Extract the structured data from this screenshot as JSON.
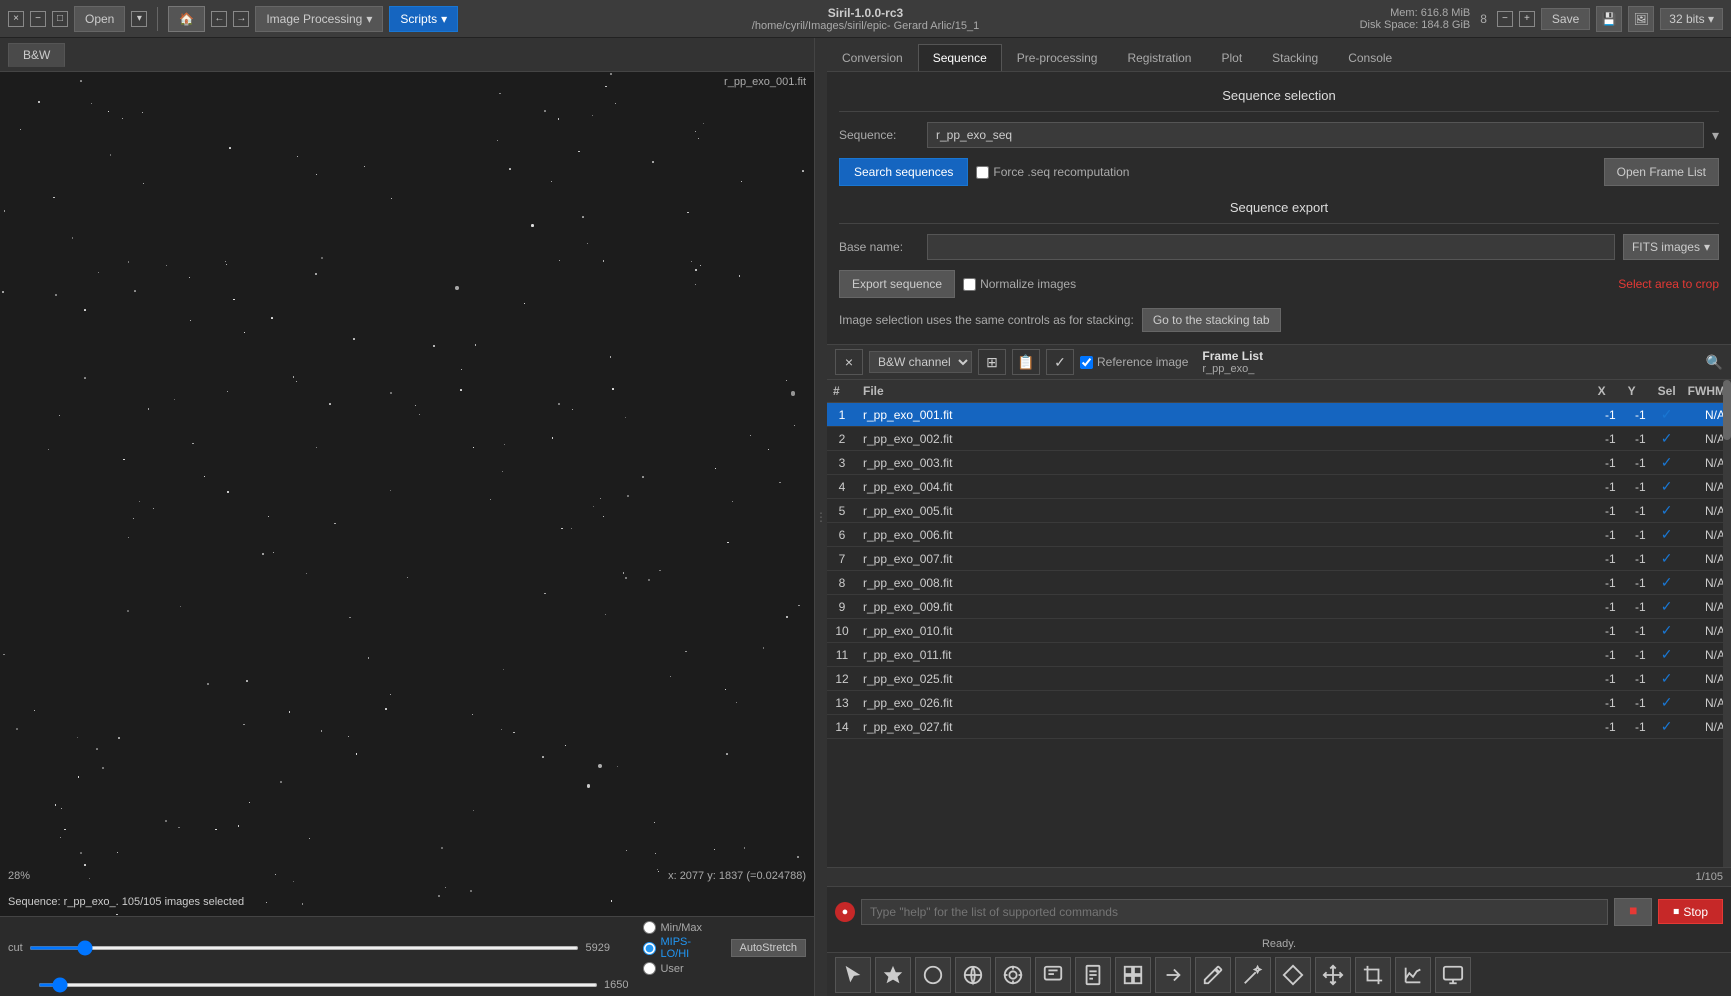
{
  "titlebar": {
    "app_name": "Siril-1.0.0-rc3",
    "file_path": "/home/cyril/Images/siril/epic- Gerard Arlic/15_1",
    "close_label": "×",
    "minimize_label": "−",
    "maximize_label": "□",
    "open_label": "Open",
    "undo_label": "←",
    "redo_label": "→",
    "image_processing_label": "Image Processing",
    "scripts_label": "Scripts",
    "save_label": "Save",
    "mem_label": "Mem: 616.8 MiB",
    "disk_label": "Disk Space: 184.8 GiB",
    "thread_count": "8",
    "bits_label": "32 bits"
  },
  "image_area": {
    "tab_label": "B&W",
    "filename": "r_pp_exo_001.fit",
    "zoom": "28%",
    "coords": "x: 2077  y: 1837  (=0.024788)",
    "seq_info": "Sequence: r_pp_exo_. 105/105 images selected"
  },
  "bottom_controls": {
    "slider1_val": "5929",
    "slider2_val": "1650",
    "min_max_label": "Min/Max",
    "mips_lohi_label": "MIPS-LO/HI",
    "user_label": "User",
    "auto_stretch_label": "AutoStretch",
    "cut_label": "cut"
  },
  "right_tabs": [
    {
      "id": "conversion",
      "label": "Conversion"
    },
    {
      "id": "sequence",
      "label": "Sequence",
      "active": true
    },
    {
      "id": "preprocessing",
      "label": "Pre-processing"
    },
    {
      "id": "registration",
      "label": "Registration"
    },
    {
      "id": "plot",
      "label": "Plot"
    },
    {
      "id": "stacking",
      "label": "Stacking"
    },
    {
      "id": "console",
      "label": "Console"
    }
  ],
  "sequence_selection": {
    "title": "Sequence selection",
    "sequence_label": "Sequence:",
    "sequence_value": "r_pp_exo_seq",
    "search_btn": "Search sequences",
    "force_recomp_label": "Force .seq recomputation",
    "open_frame_btn": "Open Frame List"
  },
  "sequence_export": {
    "title": "Sequence export",
    "base_name_label": "Base name:",
    "base_name_value": "",
    "fits_btn": "FITS images",
    "export_btn": "Export sequence",
    "normalize_label": "Normalize images",
    "select_crop": "Select area to crop",
    "image_selection_text": "Image selection uses the same controls as for stacking:",
    "goto_stack_btn": "Go to the stacking tab"
  },
  "frame_list": {
    "title": "Frame List",
    "subtitle": "r_pp_exo_",
    "channel_label": "B&W channel",
    "ref_image_label": "Reference image",
    "page_info": "1/105",
    "columns": [
      "#",
      "File",
      "X",
      "Y",
      "Sel",
      "FWHM"
    ],
    "rows": [
      {
        "num": 1,
        "file": "r_pp_exo_001.fit",
        "x": "-1",
        "y": "-1",
        "sel": true,
        "fwhm": "N/A",
        "selected": true
      },
      {
        "num": 2,
        "file": "r_pp_exo_002.fit",
        "x": "-1",
        "y": "-1",
        "sel": true,
        "fwhm": "N/A",
        "selected": false
      },
      {
        "num": 3,
        "file": "r_pp_exo_003.fit",
        "x": "-1",
        "y": "-1",
        "sel": true,
        "fwhm": "N/A",
        "selected": false
      },
      {
        "num": 4,
        "file": "r_pp_exo_004.fit",
        "x": "-1",
        "y": "-1",
        "sel": true,
        "fwhm": "N/A",
        "selected": false
      },
      {
        "num": 5,
        "file": "r_pp_exo_005.fit",
        "x": "-1",
        "y": "-1",
        "sel": true,
        "fwhm": "N/A",
        "selected": false
      },
      {
        "num": 6,
        "file": "r_pp_exo_006.fit",
        "x": "-1",
        "y": "-1",
        "sel": true,
        "fwhm": "N/A",
        "selected": false
      },
      {
        "num": 7,
        "file": "r_pp_exo_007.fit",
        "x": "-1",
        "y": "-1",
        "sel": true,
        "fwhm": "N/A",
        "selected": false
      },
      {
        "num": 8,
        "file": "r_pp_exo_008.fit",
        "x": "-1",
        "y": "-1",
        "sel": true,
        "fwhm": "N/A",
        "selected": false
      },
      {
        "num": 9,
        "file": "r_pp_exo_009.fit",
        "x": "-1",
        "y": "-1",
        "sel": true,
        "fwhm": "N/A",
        "selected": false
      },
      {
        "num": 10,
        "file": "r_pp_exo_010.fit",
        "x": "-1",
        "y": "-1",
        "sel": true,
        "fwhm": "N/A",
        "selected": false
      },
      {
        "num": 11,
        "file": "r_pp_exo_011.fit",
        "x": "-1",
        "y": "-1",
        "sel": true,
        "fwhm": "N/A",
        "selected": false
      },
      {
        "num": 12,
        "file": "r_pp_exo_025.fit",
        "x": "-1",
        "y": "-1",
        "sel": true,
        "fwhm": "N/A",
        "selected": false
      },
      {
        "num": 13,
        "file": "r_pp_exo_026.fit",
        "x": "-1",
        "y": "-1",
        "sel": true,
        "fwhm": "N/A",
        "selected": false
      },
      {
        "num": 14,
        "file": "r_pp_exo_027.fit",
        "x": "-1",
        "y": "-1",
        "sel": true,
        "fwhm": "N/A",
        "selected": false
      }
    ]
  },
  "console": {
    "placeholder": "Type \"help\" for the list of supported commands",
    "ready_text": "Ready.",
    "stop_btn": "Stop"
  },
  "bottom_tools": [
    "cursor-icon",
    "star-icon",
    "circle-icon",
    "globe-icon",
    "target-icon",
    "chat-icon",
    "doc-icon",
    "grid-icon",
    "arrow-icon",
    "pencil-icon",
    "wand-icon",
    "diamond-icon",
    "arrows-icon",
    "crop-icon",
    "chart-icon",
    "monitor-icon"
  ]
}
